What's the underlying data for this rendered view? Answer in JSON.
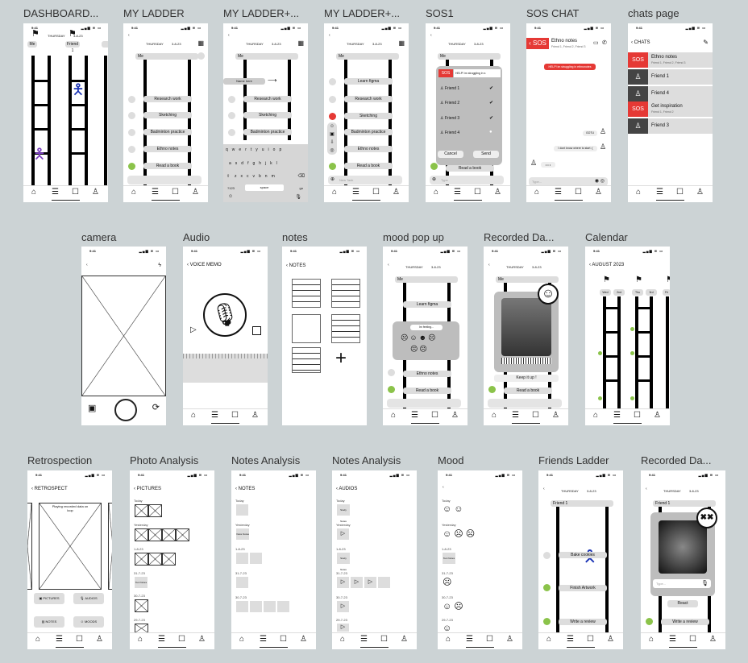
{
  "status_time": "9:41",
  "status_icons": "▂▄▆ ≋ ▭",
  "nav_icons": {
    "home": "⌂",
    "ladder": "☰",
    "chat": "☐",
    "user": "♙"
  },
  "day": "THURSDAY",
  "date": "3-8-23",
  "me": "Me",
  "frames": {
    "dashboard": "DASHBOARD...",
    "my_ladder": "MY LADDER",
    "my_ladder_plus1": "MY LADDER+...",
    "my_ladder_plus2": "MY LADDER+...",
    "sos1": "SOS1",
    "sos_chat": "SOS CHAT",
    "chats_page": "chats page",
    "camera": "camera",
    "audio": "Audio",
    "notes": "notes",
    "mood_pop_up": "mood pop up",
    "recorded_da1": "Recorded Da...",
    "calendar": "Calendar",
    "retrospection": "Retrospection",
    "photo_analysis": "Photo Analysis",
    "notes_analysis1": "Notes Analysis",
    "notes_analysis2": "Notes Analysis",
    "mood": "Mood",
    "friends_ladder": "Friends Ladder",
    "recorded_da2": "Recorded Da..."
  },
  "dashboard": {
    "day": "THURSDAY",
    "date": "3-8-23",
    "col_me": "Me",
    "col_friend": "Friend 1"
  },
  "ladder_tasks": [
    "Research work",
    "Sketching",
    "Badminton practice",
    "Ethno  notes",
    "Read a book"
  ],
  "plus1_input": "Name here",
  "keyboard": {
    "row1": [
      "q",
      "w",
      "e",
      "r",
      "t",
      "y",
      "u",
      "i",
      "o",
      "p"
    ],
    "row2": [
      "a",
      "s",
      "d",
      "f",
      "g",
      "h",
      "j",
      "k",
      "l"
    ],
    "row3": [
      "z",
      "x",
      "c",
      "v",
      "b",
      "n",
      "m"
    ],
    "num": "?123",
    "space": "space",
    "go": "go"
  },
  "plus2_tasks": [
    "Learn figma",
    "Research work",
    "Sketching",
    "Badminton practice",
    "Ethno  notes",
    "Read a book"
  ],
  "new_task": "New Task",
  "sos1": {
    "sos": "SOS",
    "msg": "HELP! im struggling in s",
    "friends": [
      "Friend 1",
      "Friend 2",
      "Friend 3",
      "Friend 4"
    ],
    "cancel": "Cancel",
    "send": "Send",
    "read": "Read a book",
    "type": "Type"
  },
  "sos_chat": {
    "title": "Ethno  notes",
    "subtitle": "Friend 1, Friend 2, Friend 3",
    "msg1": "HELP! im struggling in ethnonotes",
    "msg2": "GOTU",
    "msg3": "I dont know where to start :(",
    "typing": "• • •",
    "type": "Type..."
  },
  "chats": {
    "title": "CHATS",
    "items": [
      {
        "name": "Ethno  notes",
        "sub": "Friend 1, Friend 2, Friend 3",
        "sos": true
      },
      {
        "name": "Friend 1",
        "sub": "",
        "sos": false
      },
      {
        "name": "Friend 4",
        "sub": "",
        "sos": false
      },
      {
        "name": "Get inspiration",
        "sub": "Friend 1, Friend 2",
        "sos": true
      },
      {
        "name": "Friend 3",
        "sub": "",
        "sos": false
      }
    ],
    "sos_label": "SOS"
  },
  "audio_title": "VOICE MEMO",
  "notes_title": "NOTES",
  "mood_popup": {
    "feeling": "Im feeling...",
    "faces": [
      "☹",
      "☺",
      "☻",
      "☹",
      "☹",
      "☹"
    ],
    "tasks": [
      "Learn figma",
      "Ethno  notes",
      "Read a book"
    ]
  },
  "recorded": {
    "keep": "Keep it up !",
    "tasks": [
      "Read a book"
    ]
  },
  "calendar": {
    "title": "AUGUST 2023",
    "cols": [
      "Wed",
      "2nd",
      "Thu",
      "3rd",
      "Fri"
    ]
  },
  "retrospect": {
    "title": "RETROSPECT",
    "playing": "Playing recorded data on loop",
    "buttons": [
      "PICTURES",
      "AUDIOS",
      "NOTES",
      "MOODS"
    ]
  },
  "pictures": {
    "title": "PICTURES",
    "sections": [
      "Today",
      "Yesterday",
      "1-8-23",
      "31-7-23",
      "30-7-23",
      "29-7-23"
    ],
    "note_chip": "Text Notes"
  },
  "notes_analysis": {
    "title": "NOTES",
    "sections": [
      "Today",
      "Yesterday",
      "1-8-23",
      "31-7-23",
      "30-7-23"
    ],
    "chip": "Voice Notes"
  },
  "audios_analysis": {
    "title": "AUDIOS",
    "sections": [
      "Today",
      "Yesterday",
      "1-8-23",
      "31-7-23",
      "30-7-23",
      "29-7-23"
    ],
    "chip": "Study Notes"
  },
  "mood_screen": {
    "sections": [
      "Today",
      "Yesterday",
      "1-8-23",
      "31-7-23",
      "30-7-23",
      "29-7-23"
    ],
    "chip": "Text Notes"
  },
  "friends_ladder": {
    "friend": "Friend 1",
    "tasks": [
      "Bake cookies",
      "Finish Artwork",
      "Write a review"
    ]
  },
  "recorded2": {
    "friend": "Friend 1",
    "type": "Type...",
    "react": "React",
    "task": "Write a review"
  }
}
